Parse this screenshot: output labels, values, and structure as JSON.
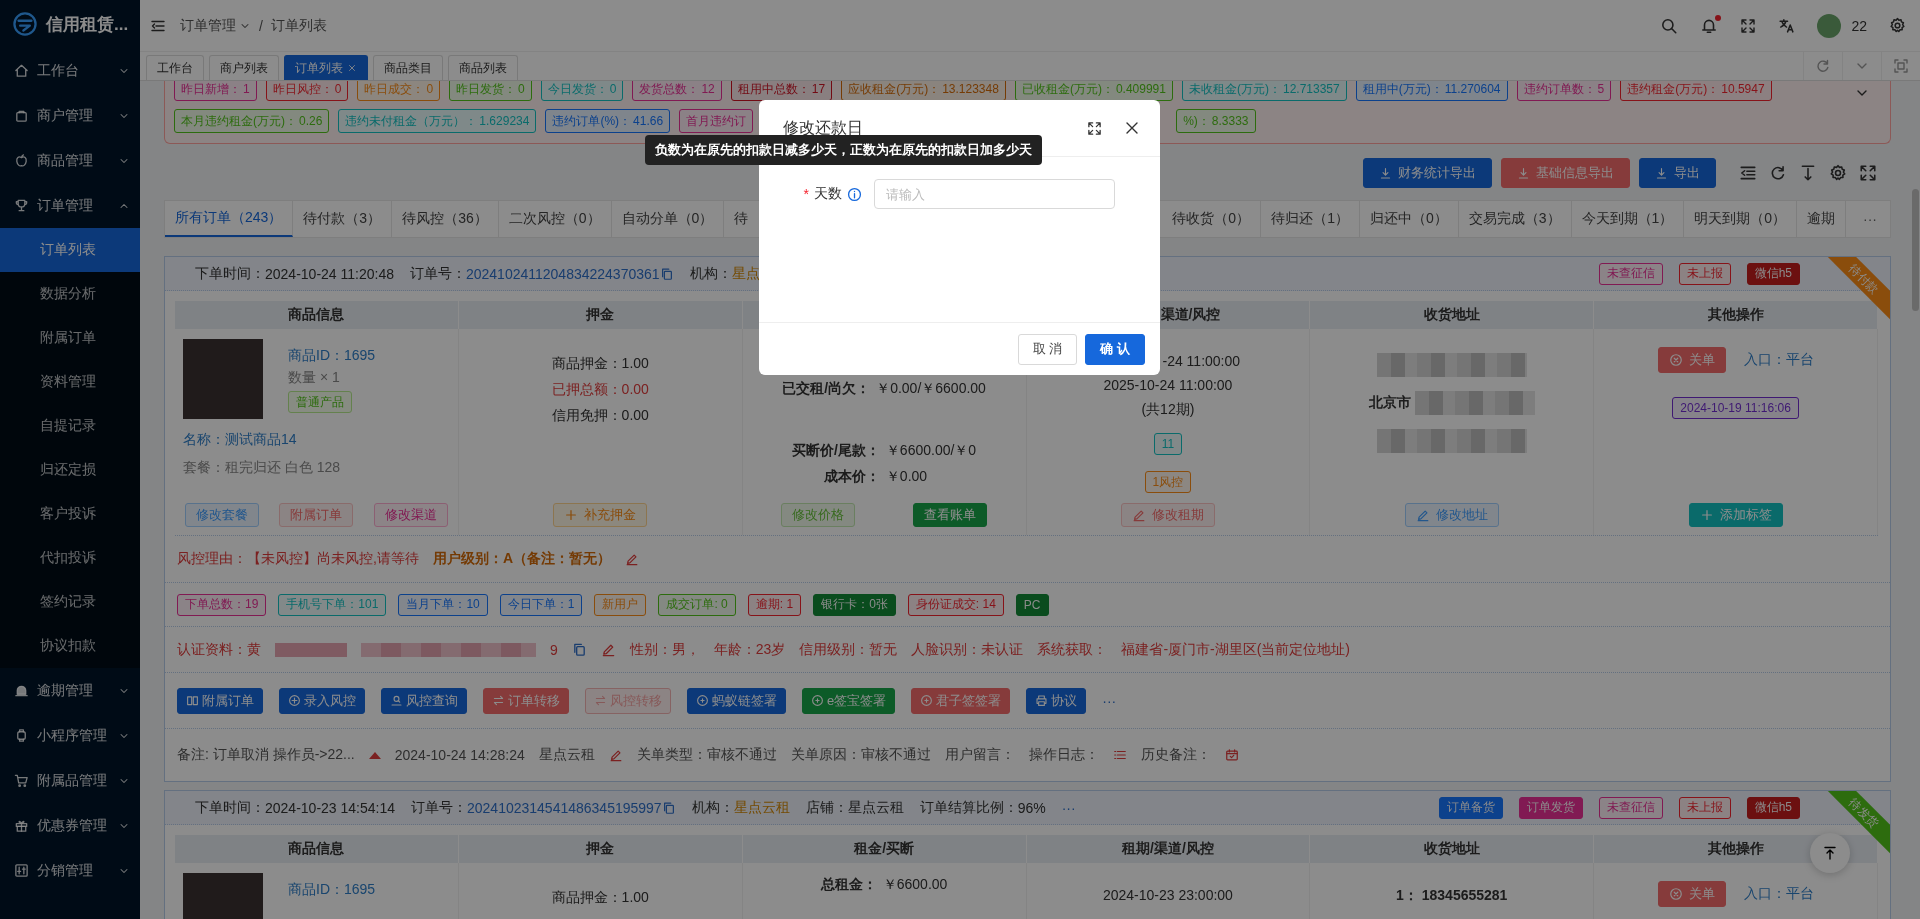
{
  "sidebar": {
    "logo": "信用租赁...",
    "items": [
      {
        "label": "工作台",
        "expanded": false
      },
      {
        "label": "商户管理",
        "expanded": false
      },
      {
        "label": "商品管理",
        "expanded": false
      },
      {
        "label": "订单管理",
        "expanded": true,
        "children": [
          {
            "label": "订单列表",
            "selected": true
          },
          {
            "label": "数据分析",
            "selected": false
          },
          {
            "label": "附属订单",
            "selected": false
          },
          {
            "label": "资料管理",
            "selected": false
          },
          {
            "label": "自提记录",
            "selected": false
          },
          {
            "label": "归还定损",
            "selected": false
          },
          {
            "label": "客户投诉",
            "selected": false
          },
          {
            "label": "代扣投诉",
            "selected": false
          },
          {
            "label": "签约记录",
            "selected": false
          },
          {
            "label": "协议扣款",
            "selected": false
          }
        ]
      },
      {
        "label": "逾期管理",
        "expanded": false
      },
      {
        "label": "小程序管理",
        "expanded": false
      },
      {
        "label": "附属品管理",
        "expanded": false
      },
      {
        "label": "优惠券管理",
        "expanded": false
      },
      {
        "label": "分销管理",
        "expanded": false
      }
    ]
  },
  "header": {
    "breadcrumb": [
      "订单管理",
      "订单列表"
    ],
    "separator": "/",
    "user": "22",
    "has_unread": true
  },
  "tag_tabs": [
    {
      "label": "工作台",
      "selected": false
    },
    {
      "label": "商户列表",
      "selected": false
    },
    {
      "label": "订单列表",
      "selected": true
    },
    {
      "label": "商品类目",
      "selected": false
    },
    {
      "label": "商品列表",
      "selected": false
    }
  ],
  "stats": [
    [
      {
        "label": "昨日新增：",
        "value": "1",
        "color": "#811a53"
      },
      {
        "label": "昨日风控：",
        "value": "0",
        "color": "#871319"
      },
      {
        "label": "昨日成交：",
        "value": "0",
        "color": "#8a4d0c"
      },
      {
        "label": "昨日发货：",
        "value": "0",
        "color": "#2d6c0e"
      },
      {
        "label": "今日发货：",
        "value": "0",
        "color": "#0a6b6b"
      },
      {
        "label": "发货总数：",
        "value": "12",
        "color": "#811a53"
      },
      {
        "label": "租用中总数：",
        "value": "17",
        "color": "#720a13"
      },
      {
        "label": "应收租金(万元)：",
        "value": "13.123348",
        "color": "#753b04"
      },
      {
        "label": "已收租金(万元)：",
        "value": "0.409991",
        "color": "#2d6c0e"
      },
      {
        "label": "未收租金(万元)：",
        "value": "12.713357",
        "color": "#0a6b6b"
      },
      {
        "label": "租用中(万元)：",
        "value": "11.270604",
        "color": "#0c418c"
      },
      {
        "label": "违约订单数：",
        "value": "5",
        "color": "#811a53"
      },
      {
        "label": "违约租金(万元)：",
        "value": "10.5947",
        "color": "#871319"
      }
    ],
    [
      {
        "label": "本月违约租金(万元)：",
        "value": "0.26",
        "color": "#2d6c0e"
      },
      {
        "label": "违约未付租金（万元）：",
        "value": "1.629234",
        "color": "#0a6b6b"
      },
      {
        "label": "违约订单(%)：",
        "value": "41.66",
        "color": "#0c418c"
      },
      {
        "label": "首月违约订",
        "color": "#811a53"
      },
      {
        "label": "%)：",
        "value": "8.3333",
        "color": "#2d6c0e"
      }
    ]
  ],
  "toolbar": [
    {
      "label": "财务统计导出",
      "kind": "primary"
    },
    {
      "label": "基础信息导出",
      "kind": "danger"
    },
    {
      "label": "导出",
      "kind": "primary"
    }
  ],
  "status_tabs": [
    {
      "label": "所有订单（243）",
      "selected": true
    },
    {
      "label": "待付款（3）",
      "selected": false
    },
    {
      "label": "待风控（36）",
      "selected": false
    },
    {
      "label": "二次风控（0）",
      "selected": false
    },
    {
      "label": "自动分单（0）",
      "selected": false
    },
    {
      "label": "待",
      "selected": false
    },
    {
      "label": "待收货（0）",
      "selected": false
    },
    {
      "label": "待归还（1）",
      "selected": false
    },
    {
      "label": "归还中（0）",
      "selected": false
    },
    {
      "label": "交易完成（3）",
      "selected": false
    },
    {
      "label": "今天到期（1）",
      "selected": false
    },
    {
      "label": "明天到期（0）",
      "selected": false
    },
    {
      "label": "逾期",
      "selected": false
    }
  ],
  "status_more": "···",
  "orders": [
    {
      "ribbon": {
        "label": "待付款",
        "color": "#8a4d0c"
      },
      "fields": [
        {
          "label": "下单时间：",
          "value": "2024-10-24 11:20:48",
          "kind": "plain"
        },
        {
          "label": "订单号：",
          "value": "2024102411204834224370361",
          "kind": "link"
        },
        {
          "label": "机构：",
          "value": "星点",
          "kind": "org"
        }
      ],
      "tags": [
        {
          "label": "未查征信",
          "color": "#811a53",
          "kind": "outline"
        },
        {
          "label": "未上报",
          "color": "#871319",
          "kind": "outline"
        },
        {
          "label": "微信h5",
          "color": "#6c1010",
          "kind": "solid"
        }
      ],
      "product": {
        "heading": "商品信息",
        "id": "商品ID：1695",
        "qty": "数量 × 1",
        "tag": "普通产品",
        "name": "名称：测试商品14",
        "package": "套餐：租完归还 白色 128",
        "buttons": [
          {
            "label": "修改套餐",
            "kind": "blue_outline"
          },
          {
            "label": "附属订单",
            "kind": "red_outline"
          },
          {
            "label": "修改渠道",
            "kind": "pink_outline"
          }
        ]
      },
      "deposit": {
        "heading": "押金",
        "lines": [
          {
            "text": "商品押金：1.00",
            "kind": "plain"
          },
          {
            "text": "已押总额：0.00",
            "kind": "alert"
          },
          {
            "text": "信用免押：0.00",
            "kind": "plain"
          }
        ],
        "button": "补充押金"
      },
      "rent": {
        "covered": true,
        "lines": [
          {
            "label": "已交租/尚欠：",
            "value": "￥0.00/￥6600.00"
          }
        ],
        "price_lines": [
          {
            "label": "买断价/尾款：",
            "value": "￥6600.00/￥0"
          },
          {
            "label": "成本价：",
            "value": "￥0.00"
          }
        ],
        "buttons": [
          {
            "label": "修改价格",
            "kind": "green_outline"
          },
          {
            "label": "查看账单",
            "kind": "success"
          }
        ]
      },
      "period": {
        "heading": "渠道/风控",
        "heading_cut": true,
        "dates": [
          {
            "text": "-24 11:00:00",
            "cut": true
          },
          {
            "text": "2025-10-24 11:00:00",
            "cut": false
          },
          {
            "text": "(共12期)",
            "cut": false
          }
        ],
        "tags": [
          {
            "label": "11",
            "color": "#0a6b6b"
          },
          {
            "label": "1风控",
            "color": "#8a4d0c"
          }
        ],
        "button": "修改租期"
      },
      "address": {
        "heading": "收货地址",
        "lines": [
          {
            "kind": "blurred"
          },
          {
            "kind": "text_blurred",
            "text": "北京市"
          },
          {
            "kind": "blurred"
          }
        ],
        "button": "修改地址"
      },
      "actions": {
        "heading": "其他操作",
        "close": "关单",
        "entry": "入口：平台",
        "tags": [
          {
            "label": "2024-10-19 11:16:06",
            "color": "#3f1973"
          }
        ],
        "button": "添加标签"
      },
      "risk": {
        "reason": "风控理由：【未风控】尚未风控,请等待",
        "level": "用户级别：A（备注：暂无）"
      },
      "user_stats": [
        {
          "label": "下单总数：19",
          "color": "#811a53",
          "kind": "outline"
        },
        {
          "label": "手机号下单：101",
          "color": "#0a6b6b",
          "kind": "outline"
        },
        {
          "label": "当月下单：10",
          "color": "#0c418c",
          "kind": "outline"
        },
        {
          "label": "今日下单：1",
          "color": "#0c418c",
          "kind": "outline"
        },
        {
          "label": "新用户",
          "color": "#8a4d0c",
          "kind": "outline"
        },
        {
          "label": "成交订单: 0",
          "color": "#2d6c0e",
          "kind": "outline"
        },
        {
          "label": "逾期: 1",
          "color": "#871319",
          "kind": "outline"
        },
        {
          "label": "银行卡：0张",
          "color": "#0a4c1e",
          "kind": "solid"
        },
        {
          "label": "身份证成交: 14",
          "color": "#871319",
          "kind": "outline"
        },
        {
          "label": "PC",
          "color": "#0a4c1e",
          "kind": "solid"
        }
      ],
      "auth": {
        "label": "认证资料：黄",
        "tail": "9",
        "items": [
          "性别：男，",
          "年龄：23岁",
          "信用级别：暂无",
          "人脸识别：未认证",
          "系统获取：",
          "福建省-厦门市-湖里区(当前定位地址)"
        ]
      },
      "action_buttons": [
        {
          "label": "附属订单",
          "kind": "primary"
        },
        {
          "label": "录入风控",
          "kind": "primary"
        },
        {
          "label": "风控查询",
          "kind": "primary"
        },
        {
          "label": "订单转移",
          "kind": "danger"
        },
        {
          "label": "风控转移",
          "kind": "light_red"
        },
        {
          "label": "蚂蚁链签署",
          "kind": "primary"
        },
        {
          "label": "e签宝签署",
          "kind": "success"
        },
        {
          "label": "君子签签署",
          "kind": "danger"
        },
        {
          "label": "协议",
          "kind": "primary"
        }
      ],
      "action_more": "···",
      "remark": {
        "note": "备注: 订单取消 操作员->22...",
        "time": "2024-10-24 14:28:24",
        "shop": "星点云租",
        "items": [
          "关单类型：审核不通过",
          "关单原因：审核不通过",
          "用户留言："
        ],
        "log": "操作日志：",
        "history": "历史备注："
      }
    },
    {
      "ribbon": {
        "label": "待发货",
        "color": "#2d6c0e"
      },
      "fields": [
        {
          "label": "下单时间：",
          "value": "2024-10-23 14:54:14",
          "kind": "plain"
        },
        {
          "label": "订单号：",
          "value": "2024102314541486345195997",
          "kind": "link"
        },
        {
          "label": "机构：",
          "value": "星点云租",
          "kind": "org"
        },
        {
          "label": "店铺：",
          "value": "星点云租",
          "kind": "plain"
        },
        {
          "label": "订单结算比例：",
          "value": "96%",
          "kind": "plain"
        }
      ],
      "more": "···",
      "tags": [
        {
          "label": "订单备货",
          "color": "#0c418c",
          "kind": "solid"
        },
        {
          "label": "订单发货",
          "color": "#811a53",
          "kind": "solid"
        },
        {
          "label": "未查征信",
          "color": "#811a53",
          "kind": "outline"
        },
        {
          "label": "未上报",
          "color": "#871319",
          "kind": "outline"
        },
        {
          "label": "微信h5",
          "color": "#6c1010",
          "kind": "solid"
        }
      ],
      "product": {
        "heading": "商品信息",
        "id": "商品ID：1695"
      },
      "deposit": {
        "heading": "押金",
        "lines": [
          {
            "text": "商品押金：1.00",
            "kind": "plain"
          }
        ]
      },
      "rent": {
        "heading": "租金/买断",
        "covered": false,
        "lines": [
          {
            "label": "总租金：",
            "value": "￥6600.00"
          }
        ]
      },
      "period": {
        "heading": "租期/渠道/风控",
        "heading_cut": false,
        "dates": [
          {
            "text": "2024-10-23 23:00:00",
            "cut": false
          }
        ]
      },
      "address": {
        "heading": "收货地址",
        "lines": [
          {
            "kind": "text",
            "text": "1：  18345655281"
          }
        ]
      },
      "actions": {
        "heading": "其他操作",
        "close": "关单",
        "entry": "入口：平台"
      }
    }
  ],
  "modal": {
    "title": "修改还款日",
    "label": "天数",
    "required_mark": "*",
    "placeholder": "请输入",
    "tooltip": "负数为在原先的扣款日减多少天，正数为在原先的扣款日加多少天",
    "buttons": [
      {
        "label": "取 消",
        "kind": "default"
      },
      {
        "label": "确 认",
        "kind": "primary"
      }
    ]
  }
}
